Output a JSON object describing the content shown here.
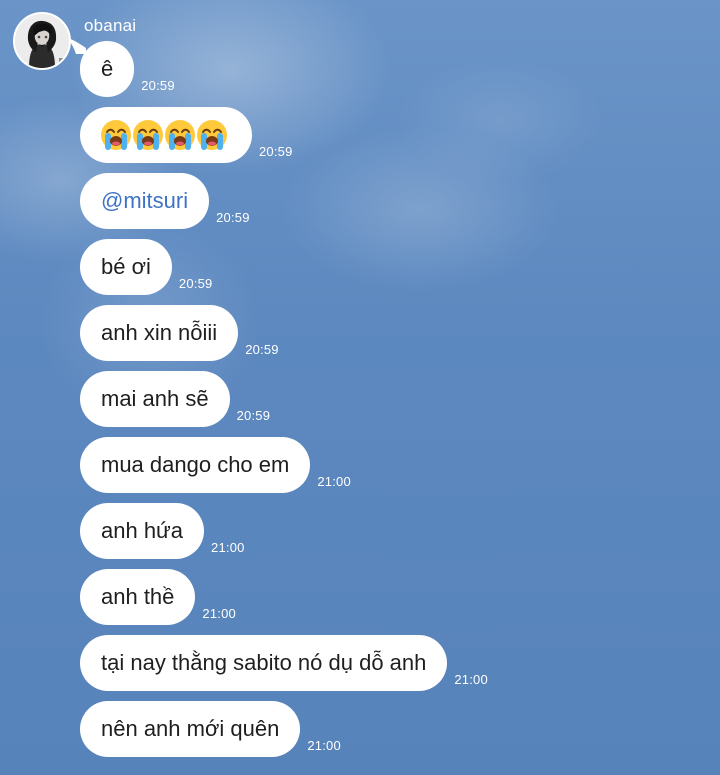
{
  "chat": {
    "sender": "obanai",
    "messages": [
      {
        "text": "ê",
        "time": "20:59"
      },
      {
        "text": "😭😭😭😭",
        "time": "20:59"
      },
      {
        "text": "@mitsuri",
        "time": "20:59"
      },
      {
        "text": "bé ơi",
        "time": "20:59"
      },
      {
        "text": "anh xin nỗiii",
        "time": "20:59"
      },
      {
        "text": "mai anh sẽ",
        "time": "20:59"
      },
      {
        "text": "mua dango cho em",
        "time": "21:00"
      },
      {
        "text": "anh hứa",
        "time": "21:00"
      },
      {
        "text": "anh thề",
        "time": "21:00"
      },
      {
        "text": "tại nay thằng sabito nó dụ dỗ anh",
        "time": "21:00"
      },
      {
        "text": "nên anh mới quên",
        "time": "21:00"
      }
    ]
  },
  "icons": {
    "avatar": "user-avatar-icon",
    "emoji": "loudly-crying-face-icon"
  },
  "colors": {
    "background": "#5f8bc1",
    "bubble": "#ffffff",
    "mention": "#3d74c7",
    "text": "#1f1f1f",
    "timestamp": "#ffffff"
  }
}
